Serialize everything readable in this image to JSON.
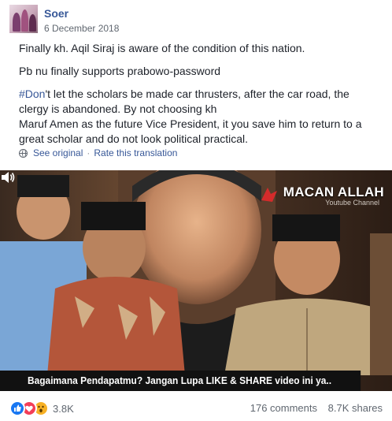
{
  "post": {
    "author": "Soer",
    "date": "6 December 2018",
    "paragraphs": {
      "p1": "Finally kh. Aqil Siraj is aware of the condition of this nation.",
      "p2": "Pb nu finally supports prabowo-password",
      "p3_hashtag": "#Don",
      "p3_rest": "'t let the scholars be made car thrusters, after the car road, the clergy is abandoned. By not choosing kh",
      "p4": "Maruf Amen as the future Vice President, it you save him to return to a great scholar and do not look political practical."
    },
    "translation": {
      "icon": "globe-icon",
      "see_original": "See original",
      "separator": "·",
      "rate": "Rate this translation"
    }
  },
  "video": {
    "brand_name": "MACAN ALLAH",
    "brand_sub": "Youtube Channel",
    "caption": "Bagaimana Pendapatmu? Jangan Lupa LIKE & SHARE video ini ya..",
    "volume_icon": "volume-icon",
    "colors": {
      "caption_bg": "#111111",
      "brand_red": "#d42b2b"
    }
  },
  "footer": {
    "reaction_icons": [
      "like-icon",
      "love-icon",
      "wow-icon"
    ],
    "reaction_count": "3.8K",
    "comments": "176 comments",
    "shares": "8.7K shares"
  },
  "colors": {
    "link": "#385898",
    "text": "#1d2129",
    "meta": "#606770",
    "like": "#1877f2",
    "love": "#f33e58",
    "wow": "#f7b125"
  }
}
